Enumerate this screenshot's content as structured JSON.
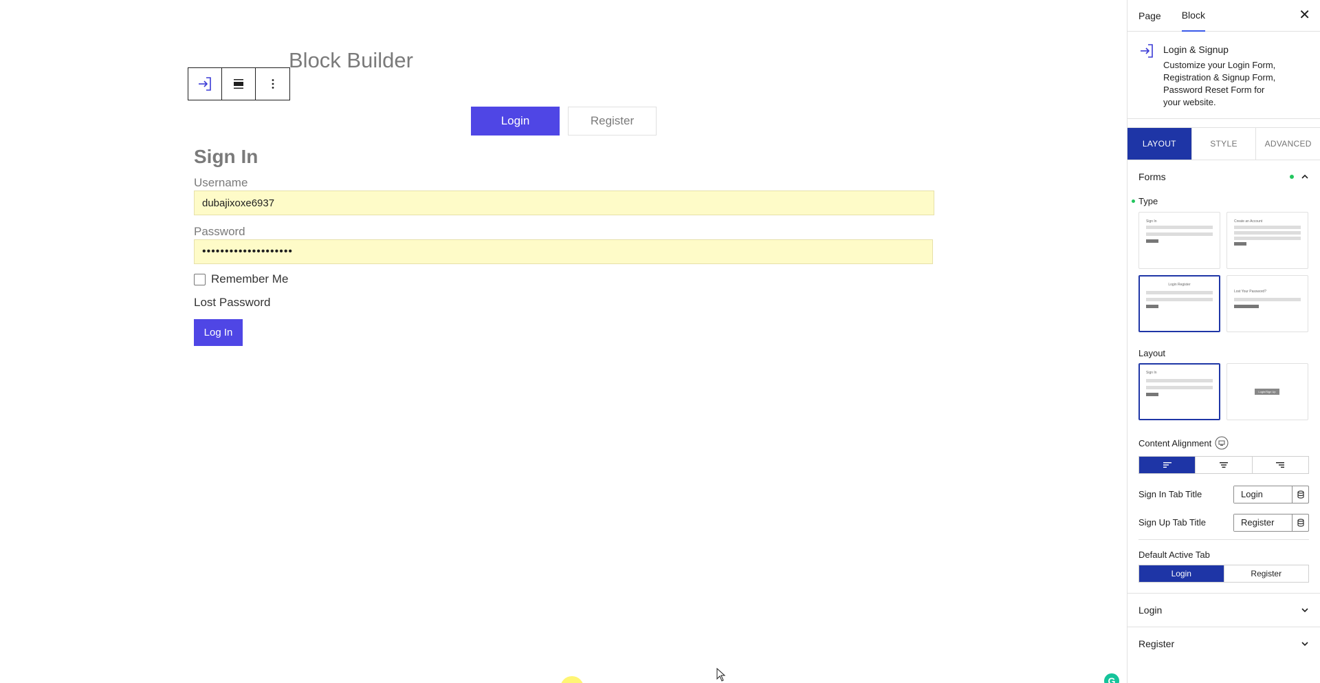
{
  "canvas": {
    "page_title": "Block Builder",
    "toolbar": {
      "block_icon": "login-arrow-icon",
      "align_icon": "align-icon",
      "more_icon": "more-vertical-icon"
    },
    "tabs": {
      "login_label": "Login",
      "register_label": "Register"
    },
    "form": {
      "heading": "Sign In",
      "username_label": "Username",
      "username_value": "dubajixoxe6937",
      "password_label": "Password",
      "password_value": "••••••••••••••••••••",
      "remember_label": "Remember Me",
      "lost_password_label": "Lost Password",
      "submit_label": "Log In"
    },
    "colors": {
      "accent": "#4f46e5",
      "autofill": "#fefbc8"
    }
  },
  "sidebar": {
    "tabs": {
      "page": "Page",
      "block": "Block"
    },
    "block_card": {
      "title": "Login & Signup",
      "description": "Customize your Login Form, Registration & Signup Form, Password Reset Form for your website."
    },
    "panel_tabs": {
      "layout": "LAYOUT",
      "style": "STYLE",
      "advanced": "ADVANCED"
    },
    "forms_section": {
      "title": "Forms",
      "type_label": "Type",
      "type_thumbs": [
        {
          "title": "Sign In"
        },
        {
          "title": "Create an Account"
        },
        {
          "title": "Login   Register"
        },
        {
          "title": "Lost Your Password?"
        }
      ],
      "layout_label": "Layout",
      "layout_thumbs": [
        {
          "title": "Sign In"
        },
        {
          "title": "Login/Sign Up"
        }
      ],
      "content_alignment_label": "Content Alignment",
      "sign_in_tab_title_label": "Sign In Tab Title",
      "sign_in_tab_title_value": "Login",
      "sign_up_tab_title_label": "Sign Up Tab Title",
      "sign_up_tab_title_value": "Register",
      "default_active_tab_label": "Default Active Tab",
      "default_active_options": [
        "Login",
        "Register"
      ]
    },
    "collapsed_sections": [
      "Login",
      "Register"
    ],
    "colors": {
      "panel_active": "#1e35a6",
      "tab_underline": "#3858e9",
      "status_dot": "#22c55e"
    }
  }
}
